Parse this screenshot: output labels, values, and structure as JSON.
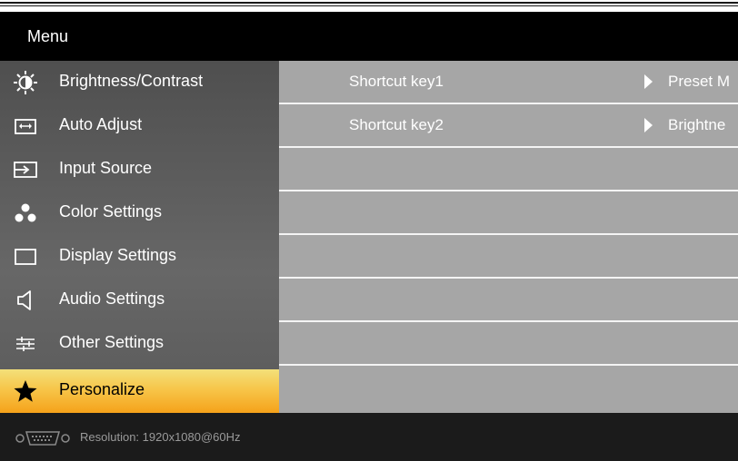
{
  "title": "Menu",
  "menu": [
    {
      "label": "Brightness/Contrast",
      "icon": "brightness-icon",
      "selected": false
    },
    {
      "label": "Auto Adjust",
      "icon": "auto-adjust-icon",
      "selected": false
    },
    {
      "label": "Input Source",
      "icon": "input-source-icon",
      "selected": false
    },
    {
      "label": "Color Settings",
      "icon": "color-settings-icon",
      "selected": false
    },
    {
      "label": "Display Settings",
      "icon": "display-settings-icon",
      "selected": false
    },
    {
      "label": "Audio Settings",
      "icon": "speaker-icon",
      "selected": false
    },
    {
      "label": "Other Settings",
      "icon": "sliders-icon",
      "selected": false
    },
    {
      "label": "Personalize",
      "icon": "star-icon",
      "selected": true
    }
  ],
  "rows": [
    {
      "label": "Shortcut key1",
      "value": "Preset M"
    },
    {
      "label": "Shortcut key2",
      "value": "Brightne"
    }
  ],
  "footer": {
    "resolution": "Resolution:  1920x1080@60Hz",
    "connector_icon": "vga-connector-icon"
  },
  "colors": {
    "menu_bg": "#5f5f5f",
    "highlight": "#f7c64a",
    "content_bg": "#a6a6a6",
    "divider": "#f4f4f4",
    "footer_bg": "#1b1b1b"
  }
}
